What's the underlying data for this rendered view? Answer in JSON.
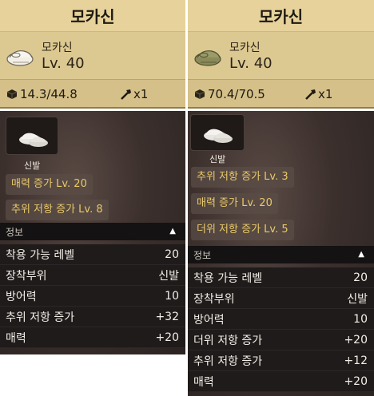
{
  "panels": [
    {
      "title": "모카신",
      "item_name": "모카신",
      "level": "Lv. 40",
      "weight": "14.3/44.8",
      "count": "x1",
      "shoe_color": "#f2efe6",
      "type_label": "신발",
      "tags": [
        "매력 증가 Lv. 20",
        "추위 저항 증가 Lv. 8"
      ],
      "info_title": "정보",
      "info_rows": [
        {
          "label": "착용 가능 레벨",
          "value": "20"
        },
        {
          "label": "장착부위",
          "value": "신발"
        },
        {
          "label": "방어력",
          "value": "10"
        },
        {
          "label": "추위 저항 증가",
          "value": "+32"
        },
        {
          "label": "매력",
          "value": "+20"
        }
      ]
    },
    {
      "title": "모카신",
      "item_name": "모카신",
      "level": "Lv. 40",
      "weight": "70.4/70.5",
      "count": "x1",
      "shoe_color": "#8a8a5a",
      "type_label": "신발",
      "tags": [
        "추위 저항 증가 Lv. 3",
        "매력 증가 Lv. 20",
        "더위 저항 증가 Lv. 5"
      ],
      "info_title": "정보",
      "info_rows": [
        {
          "label": "착용 가능 레벨",
          "value": "20"
        },
        {
          "label": "장착부위",
          "value": "신발"
        },
        {
          "label": "방어력",
          "value": "10"
        },
        {
          "label": "더위 저항 증가",
          "value": "+20"
        },
        {
          "label": "추위 저항 증가",
          "value": "+12"
        },
        {
          "label": "매력",
          "value": "+20"
        }
      ]
    }
  ],
  "colors": {
    "title_bg": "#e6d29a",
    "tag_text": "#e9c96a",
    "info_header_bg": "#141212"
  },
  "icons": {
    "weight": "cube-icon",
    "count": "hammer-icon",
    "collapse": "triangle-up-icon"
  }
}
